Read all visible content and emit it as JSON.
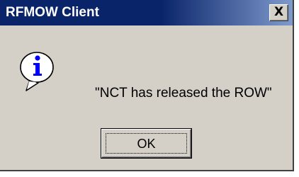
{
  "window": {
    "title": "RFMOW Client"
  },
  "titlebar": {
    "close_label": "X",
    "close_icon": "close-icon"
  },
  "dialog": {
    "icon": "info-icon",
    "message": "\"NCT has released the ROW\""
  },
  "buttons": {
    "ok_label": "OK"
  },
  "colors": {
    "titlebar_active": "#0a246a",
    "titlebar_gradient_end": "#7f9bcc",
    "dialog_face": "#d4d0c8",
    "info_icon_blue": "#0000ff"
  }
}
